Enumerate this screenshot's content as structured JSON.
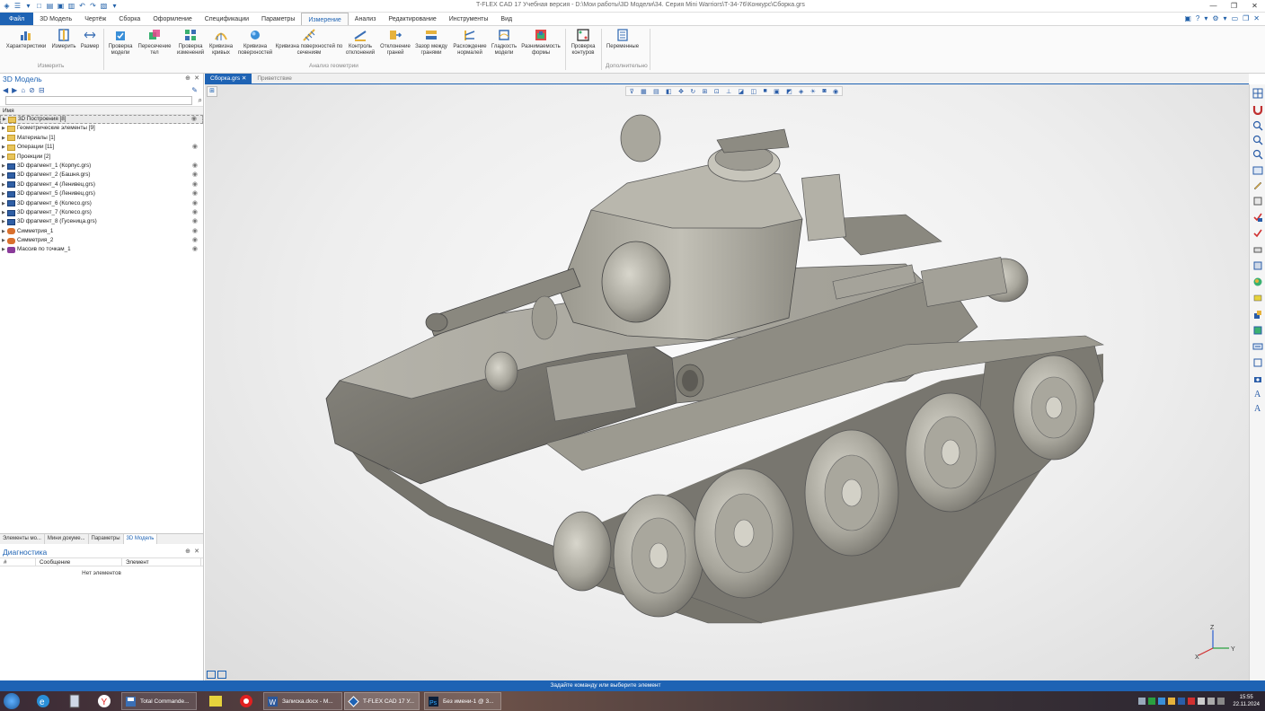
{
  "app": {
    "title": "T-FLEX CAD 17 Учебная версия - D:\\Мои работы\\3D Модели\\34. Серия Mini Warriors\\Т-34-76\\Конкурс\\Сборка.grs"
  },
  "menu": {
    "file": "Файл",
    "tabs": [
      "3D Модель",
      "Чертёж",
      "Сборка",
      "Оформление",
      "Спецификации",
      "Параметры",
      "Измерение",
      "Анализ",
      "Редактирование",
      "Инструменты",
      "Вид"
    ]
  },
  "ribbon": {
    "buttons": [
      "Характеристики",
      "Измерить",
      "Размер",
      "Проверка модели",
      "Пересечение тел",
      "Проверка изменений",
      "Кривизна кривых",
      "Кривизна поверхностей",
      "Кривизна поверхностей по сечениям",
      "Контроль отклонений",
      "Отклонение граней",
      "Зазор между гранями",
      "Расхождение нормалей",
      "Гладкость модели",
      "Разнимаемость формы",
      "Проверка контуров",
      "Переменные"
    ],
    "groups": [
      "Измерить",
      "Анализ геометрии",
      "Дополнительно"
    ]
  },
  "left_panel": {
    "title": "3D Модель",
    "column_header": "Имя",
    "tree": [
      {
        "label": "3D Построения [8]",
        "kind": "folder",
        "selected": true,
        "eye": true
      },
      {
        "label": "Геометрические элементы [9]",
        "kind": "folder",
        "selected": false,
        "eye": false
      },
      {
        "label": "Материалы [1]",
        "kind": "folder",
        "selected": false,
        "eye": false
      },
      {
        "label": "Операции [11]",
        "kind": "folder",
        "selected": false,
        "eye": true
      },
      {
        "label": "Проекции [2]",
        "kind": "folder",
        "selected": false,
        "eye": false
      },
      {
        "label": "3D фрагмент_1 (Корпус.grs)",
        "kind": "frag",
        "selected": false,
        "eye": true
      },
      {
        "label": "3D фрагмент_2 (Башня.grs)",
        "kind": "frag",
        "selected": false,
        "eye": true
      },
      {
        "label": "3D фрагмент_4 (Ленивец.grs)",
        "kind": "frag",
        "selected": false,
        "eye": true
      },
      {
        "label": "3D фрагмент_5 (Ленивец.grs)",
        "kind": "frag",
        "selected": false,
        "eye": true
      },
      {
        "label": "3D фрагмент_6 (Колесо.grs)",
        "kind": "frag",
        "selected": false,
        "eye": true
      },
      {
        "label": "3D фрагмент_7 (Колесо.grs)",
        "kind": "frag",
        "selected": false,
        "eye": true
      },
      {
        "label": "3D фрагмент_8 (Гусеница.grs)",
        "kind": "frag",
        "selected": false,
        "eye": true
      },
      {
        "label": "Симметрия_1",
        "kind": "sym",
        "selected": false,
        "eye": true
      },
      {
        "label": "Симметрия_2",
        "kind": "sym",
        "selected": false,
        "eye": true
      },
      {
        "label": "Массив по точкам_1",
        "kind": "arr",
        "selected": false,
        "eye": true
      }
    ],
    "bottom_tabs": [
      "Элементы мо...",
      "Мини докуме...",
      "Параметры",
      "3D Модель"
    ]
  },
  "diagnostics": {
    "title": "Диагностика",
    "columns": [
      "#",
      "Сообщение",
      "Элемент"
    ],
    "empty_text": "Нет элементов"
  },
  "doc_tabs": [
    "Сборка.grs",
    "Приветствие"
  ],
  "status": {
    "text": "Задайте команду или выберите элемент"
  },
  "axes": {
    "x": "X",
    "y": "Y",
    "z": "Z"
  },
  "taskbar": {
    "apps": [
      "Total Commande...",
      "Записка.docx - M...",
      "T-FLEX CAD 17 У...",
      "Без имени-1 @ 3..."
    ],
    "time": "15:55",
    "date": "22.11.2024"
  },
  "colors": {
    "accent": "#1e63b4",
    "status_bar": "#1e63b4",
    "model": "#a7a59b"
  }
}
